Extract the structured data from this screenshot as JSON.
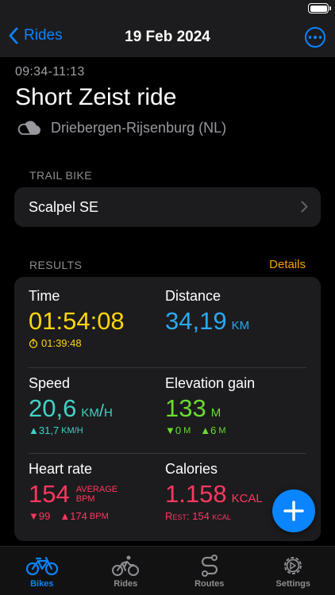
{
  "nav": {
    "back_label": "Rides",
    "title": "19 Feb 2024"
  },
  "ride": {
    "time_range": "09:34-11:13",
    "title": "Short Zeist ride",
    "location": "Driebergen-Rijsenburg (NL)"
  },
  "trail_bike": {
    "header": "TRAIL BIKE",
    "name": "Scalpel SE"
  },
  "results": {
    "header": "RESULTS",
    "details_label": "Details",
    "time": {
      "label": "Time",
      "value": "01:54:08",
      "sub": "01:39:48"
    },
    "distance": {
      "label": "Distance",
      "value": "34,19",
      "unit": "km"
    },
    "speed": {
      "label": "Speed",
      "value": "20,6",
      "unit": "km/h",
      "max": "▲31,7",
      "max_unit": "km/h"
    },
    "elevation": {
      "label": "Elevation gain",
      "value": "133",
      "unit": "m",
      "down": "▼0",
      "down_unit": "m",
      "up": "▲6",
      "up_unit": "m"
    },
    "heart_rate": {
      "label": "Heart rate",
      "value": "154",
      "unit_line1": "Average",
      "unit_line2": "BPM",
      "min": "▼99",
      "max": "▲174",
      "max_unit": "bpm"
    },
    "calories": {
      "label": "Calories",
      "value": "1.158",
      "unit": "kcal",
      "rest_label": "Rest: 154 kcal"
    }
  },
  "tabs": [
    {
      "label": "Bikes",
      "icon": "bike-icon",
      "active": true
    },
    {
      "label": "Rides",
      "icon": "cyclist-icon",
      "active": false
    },
    {
      "label": "Routes",
      "icon": "route-icon",
      "active": false
    },
    {
      "label": "Settings",
      "icon": "gear-icon",
      "active": false
    }
  ],
  "colors": {
    "accent": "#0a84ff",
    "time": "#ffd60a",
    "distance": "#2aa8f2",
    "speed": "#40d3c6",
    "elevation": "#6bdc30",
    "heart_rate": "#ff375f",
    "details": "#ff9f0a"
  }
}
